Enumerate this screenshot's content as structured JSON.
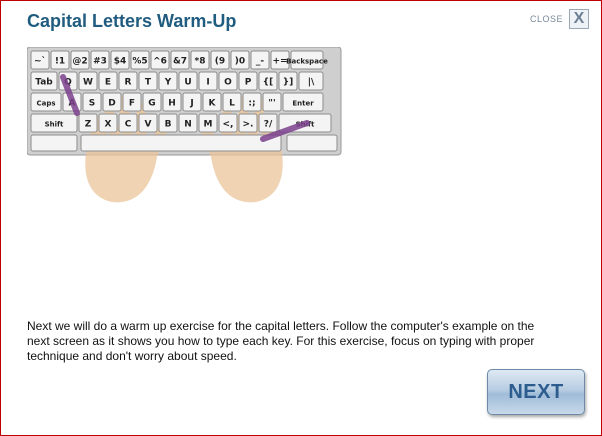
{
  "header": {
    "title": "Capital Letters Warm-Up",
    "close_label": "CLOSE",
    "close_icon": "X"
  },
  "keyboard": {
    "rows": [
      [
        "~`",
        "!1",
        "@2",
        "#3",
        "$4",
        "%5",
        "^6",
        "&7",
        "*8",
        "(9",
        ")0",
        "_-",
        "+=",
        "Backspace"
      ],
      [
        "Tab",
        "Q",
        "W",
        "E",
        "R",
        "T",
        "Y",
        "U",
        "I",
        "O",
        "P",
        "{[",
        "}]",
        "|\\"
      ],
      [
        "Caps",
        "A",
        "S",
        "D",
        "F",
        "G",
        "H",
        "J",
        "K",
        "L",
        ":;",
        "\"'",
        "Enter"
      ],
      [
        "Shift",
        "Z",
        "X",
        "C",
        "V",
        "B",
        "N",
        "M",
        "<,",
        ">.",
        "?/",
        "Shift"
      ]
    ]
  },
  "instructions": "Next we will do a warm up exercise for the capital letters. Follow the computer's example on the next screen as it shows you how to type each key. For this exercise, focus on typing with proper technique and don't worry about speed.",
  "next_button": {
    "label": "NEXT"
  },
  "colors": {
    "title": "#1f5c80",
    "frame_border": "#c00000",
    "finger_highlight": "#7b3f8c"
  }
}
